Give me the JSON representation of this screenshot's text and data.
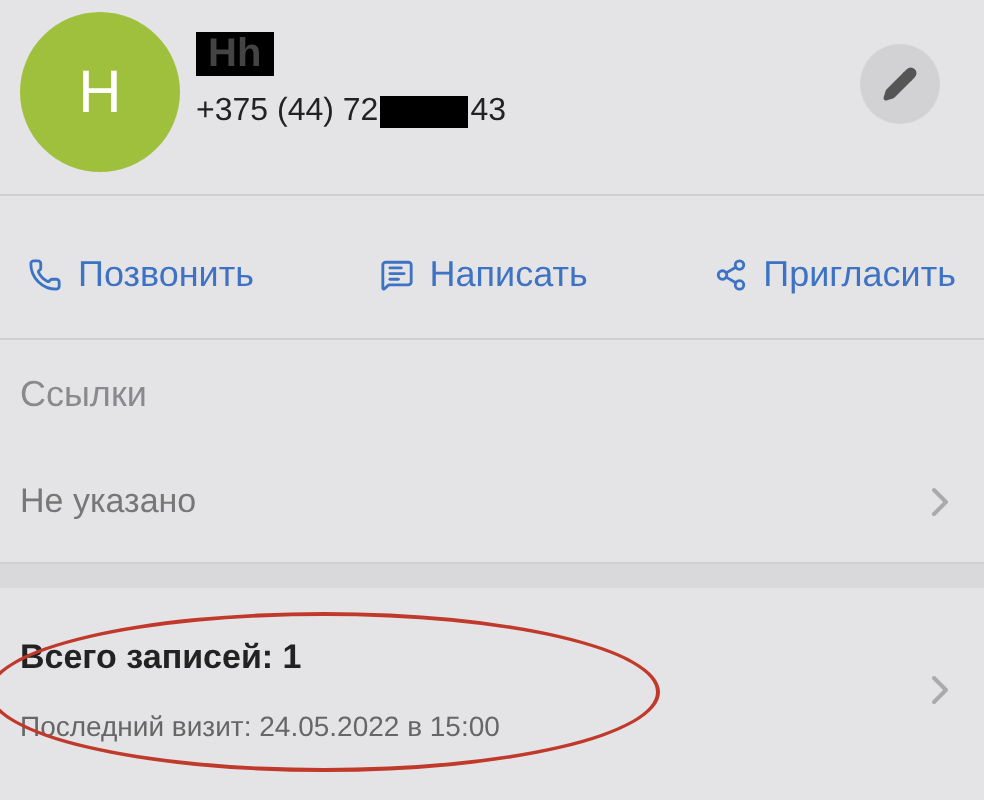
{
  "contact": {
    "avatar_letter": "H",
    "name": "Hh",
    "phone_start": "+375 (44) 72",
    "phone_end": "43"
  },
  "actions": [
    {
      "kind": "call",
      "label": "Позвонить"
    },
    {
      "kind": "message",
      "label": "Написать"
    },
    {
      "kind": "invite",
      "label": "Пригласить"
    }
  ],
  "links": {
    "title": "Ссылки",
    "value": "Не указано"
  },
  "visits": {
    "total": "Всего записей: 1",
    "last": "Последний визит: 24.05.2022 в 15:00"
  }
}
